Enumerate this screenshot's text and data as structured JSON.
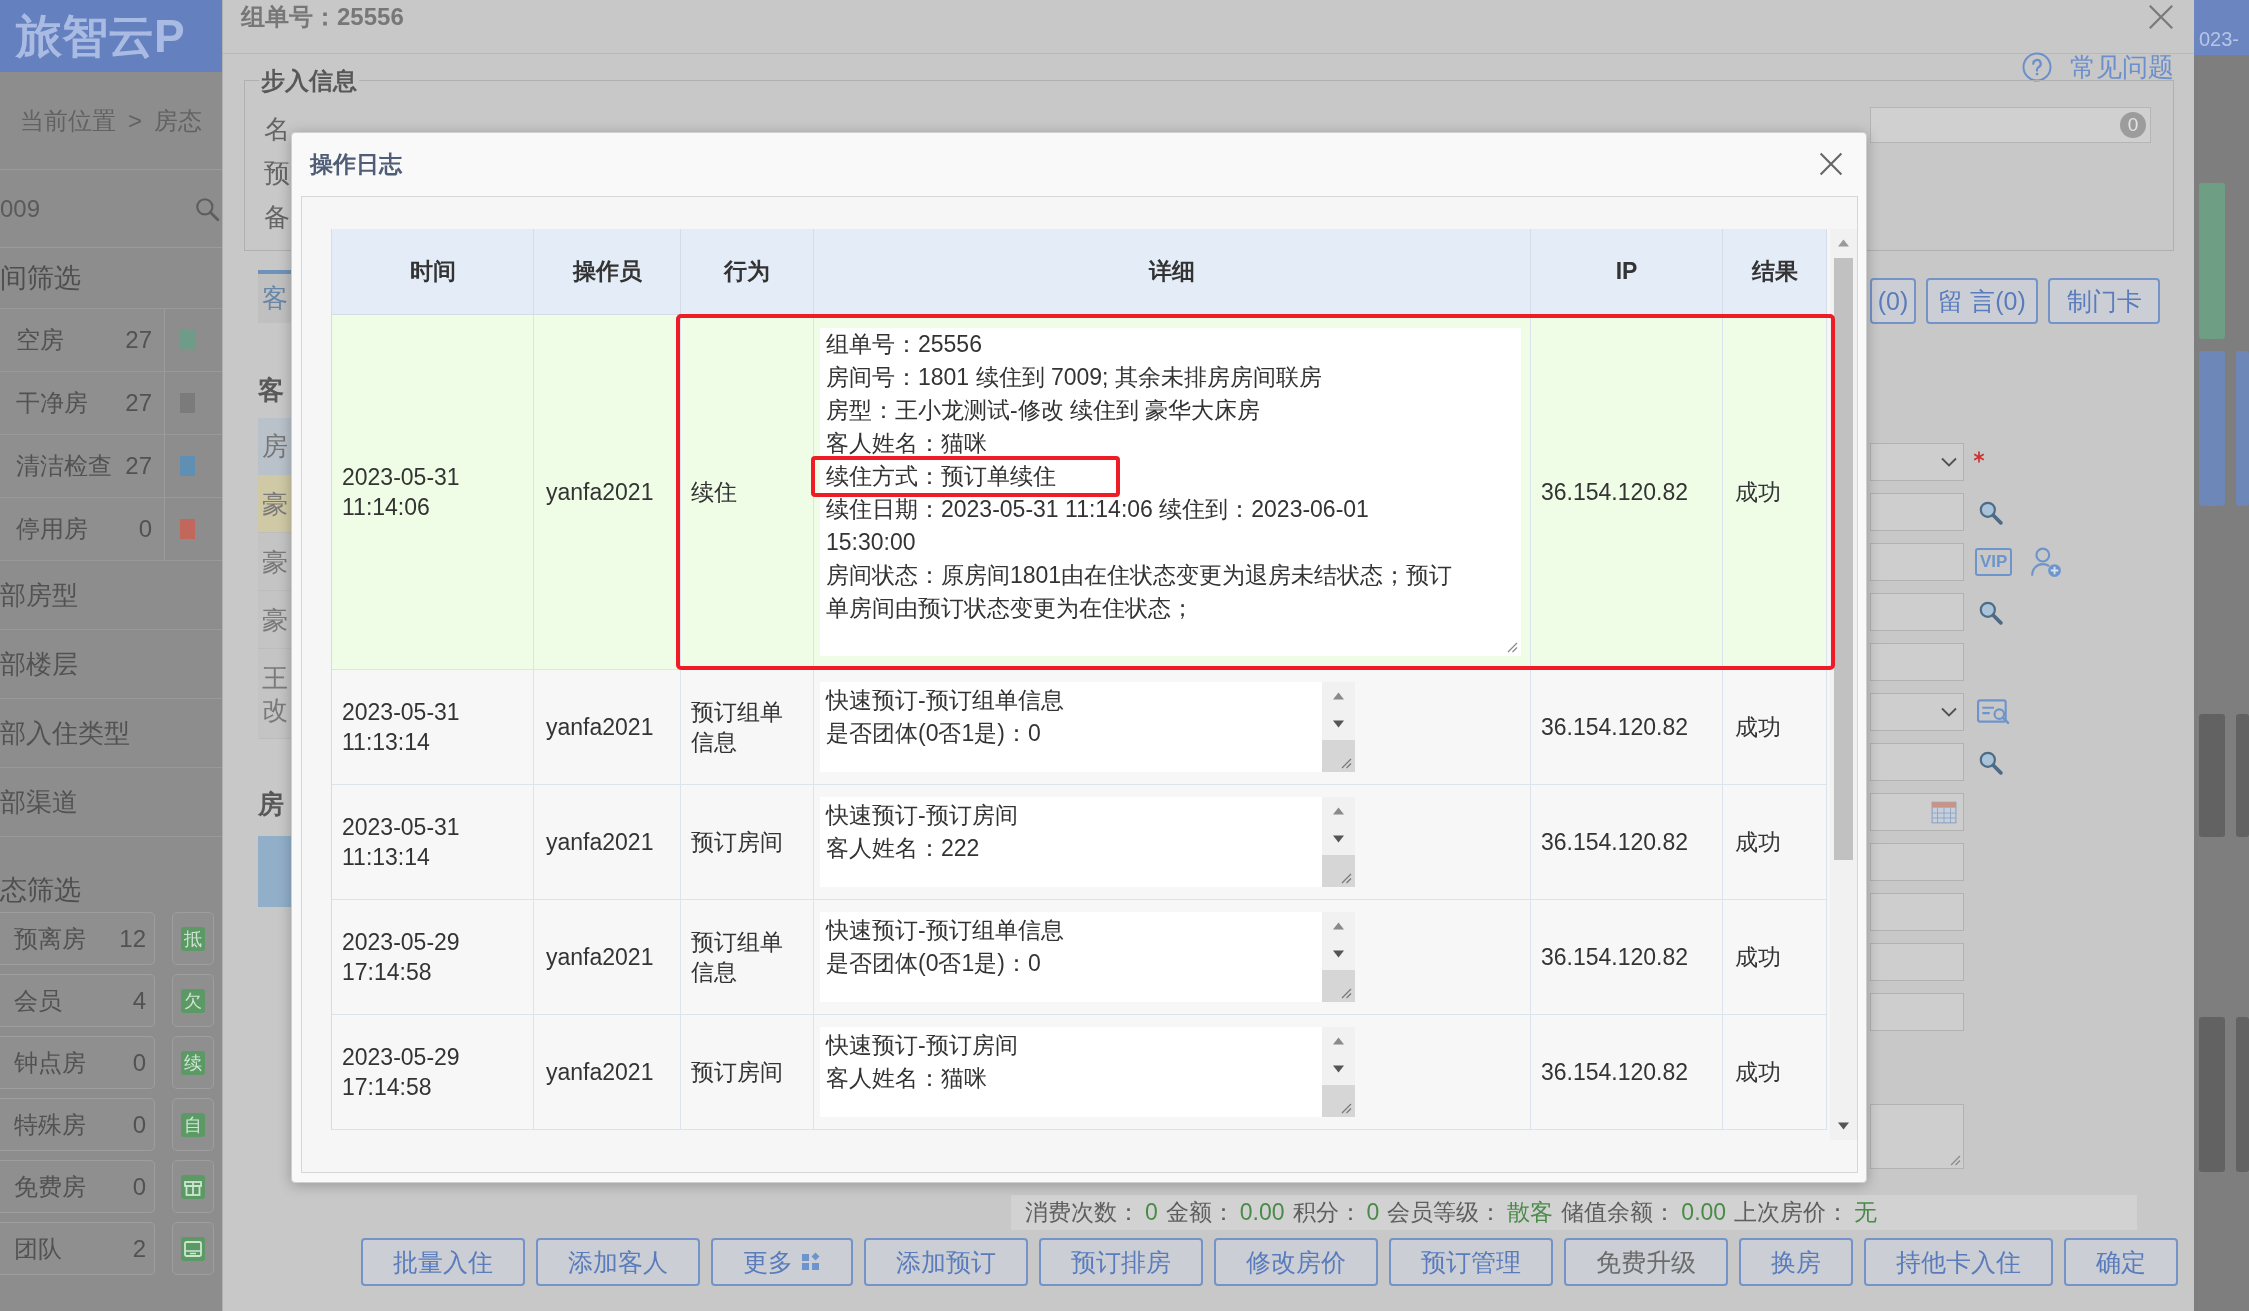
{
  "sidebar": {
    "logo": "旅智云P",
    "breadcrumb": {
      "items": [
        "当前位置",
        "房态"
      ],
      "separator": ">"
    },
    "search": {
      "value": "009"
    },
    "room_filter": {
      "title": "间筛选",
      "items": [
        {
          "label": "空房",
          "count": "27",
          "color": "#6f9c88"
        },
        {
          "label": "干净房",
          "count": "27",
          "color": "#7b7b7b"
        },
        {
          "label": "清洁检查",
          "count": "27",
          "color": "#5f8fb2"
        },
        {
          "label": "停用房",
          "count": "0",
          "color": "#c2675b"
        }
      ]
    },
    "groups": [
      "部房型",
      "部楼层",
      "部入住类型",
      "部渠道"
    ],
    "status_filter": {
      "title": "态筛选",
      "items": [
        {
          "label": "预离房",
          "count": "12",
          "kind": "tag",
          "tag": "抵"
        },
        {
          "label": "会员",
          "count": "4",
          "kind": "tag",
          "tag": "欠"
        },
        {
          "label": "钟点房",
          "count": "0",
          "kind": "tag",
          "tag": "续"
        },
        {
          "label": "特殊房",
          "count": "0",
          "kind": "tag",
          "tag": "自"
        },
        {
          "label": "免费房",
          "count": "0",
          "kind": "gift"
        },
        {
          "label": "团队",
          "count": "2",
          "kind": "card"
        }
      ]
    }
  },
  "dialog": {
    "title": "组单号：25556",
    "help": "常见问题",
    "checkin": {
      "legend": "步入信息",
      "labels": [
        "名",
        "预",
        "备"
      ],
      "order_badge": "0"
    },
    "tab": "客",
    "guest_panel": {
      "legend": "客",
      "header": "房",
      "rows": [
        {
          "text": "豪",
          "selected": true
        },
        {
          "text": "豪",
          "selected": false
        },
        {
          "text": "豪",
          "selected": false
        },
        {
          "text": "王改",
          "selected": false
        }
      ]
    },
    "room_panel": {
      "legend": "房"
    },
    "side_buttons": [
      "(0)",
      "留 言(0)",
      "制门卡"
    ],
    "fields": [
      {
        "kind": "select",
        "required": true
      },
      {
        "kind": "search",
        "required": false
      },
      {
        "kind": "vip",
        "badge": "VIP",
        "required": false
      },
      {
        "kind": "search",
        "required": false
      },
      {
        "kind": "text",
        "required": false
      },
      {
        "kind": "lookup",
        "required": false
      },
      {
        "kind": "search",
        "required": false
      },
      {
        "kind": "date",
        "required": false
      },
      {
        "kind": "text",
        "required": false
      },
      {
        "kind": "text",
        "required": false
      },
      {
        "kind": "text",
        "required": false
      },
      {
        "kind": "text",
        "required": false
      },
      {
        "kind": "textarea",
        "required": false
      }
    ],
    "summary": [
      {
        "label": "消费次数：",
        "value": "0"
      },
      {
        "label": "金额：",
        "value": "0.00"
      },
      {
        "label": "积分：",
        "value": "0"
      },
      {
        "label": "会员等级：",
        "value": "散客"
      },
      {
        "label": "储值余额：",
        "value": "0.00"
      },
      {
        "label": "上次房价：",
        "value": "无"
      }
    ],
    "buttons": [
      {
        "label": "批量入住",
        "kind": "plain",
        "disabled": false
      },
      {
        "label": "添加客人",
        "kind": "plain",
        "disabled": false
      },
      {
        "label": "更多",
        "kind": "more",
        "disabled": false
      },
      {
        "label": "添加预订",
        "kind": "plain",
        "disabled": false
      },
      {
        "label": "预订排房",
        "kind": "plain",
        "disabled": false
      },
      {
        "label": "修改房价",
        "kind": "plain",
        "disabled": false
      },
      {
        "label": "预订管理",
        "kind": "plain",
        "disabled": false
      },
      {
        "label": "免费升级",
        "kind": "plain",
        "disabled": true
      },
      {
        "label": "换房",
        "kind": "plain",
        "disabled": false
      },
      {
        "label": "持他卡入住",
        "kind": "plain",
        "disabled": false
      },
      {
        "label": "确定",
        "kind": "plain",
        "disabled": false
      }
    ]
  },
  "side_strip": {
    "date_text": "023-"
  },
  "log": {
    "title": "操作日志",
    "columns": [
      "时间",
      "操作员",
      "行为",
      "详细",
      "IP",
      "结果"
    ],
    "rows": [
      {
        "time": "2023-05-31 11:14:06",
        "operator": "yanfa2021",
        "action": "续住",
        "detail": [
          {
            "text": "组单号：25556",
            "marked": false
          },
          {
            "text": "房间号：1801 续住到 7009; 其余未排房房间联房",
            "marked": false
          },
          {
            "text": "房型：王小龙测试-修改 续住到 豪华大床房",
            "marked": false
          },
          {
            "text": "客人姓名：猫咪",
            "marked": false
          },
          {
            "text": "续住方式：预订单续住",
            "marked": true
          },
          {
            "text": "续住日期：2023-05-31 11:14:06 续住到：2023-06-01 15:30:00",
            "marked": false
          },
          {
            "text": "房间状态：原房间1801由在住状态变更为退房未结状态；预订单房间由预订状态变更为在住状态；",
            "marked": false
          }
        ],
        "ip": "36.154.120.82",
        "result": "成功",
        "selected": true,
        "marked": true
      },
      {
        "time": "2023-05-31 11:13:14",
        "operator": "yanfa2021",
        "action": "预订组单信息",
        "detail": [
          {
            "text": "快速预订-预订组单信息",
            "marked": false
          },
          {
            "text": "是否团体(0否1是)：0",
            "marked": false
          }
        ],
        "ip": "36.154.120.82",
        "result": "成功",
        "selected": false,
        "marked": false
      },
      {
        "time": "2023-05-31 11:13:14",
        "operator": "yanfa2021",
        "action": "预订房间",
        "detail": [
          {
            "text": "快速预订-预订房间",
            "marked": false
          },
          {
            "text": "客人姓名：222",
            "marked": false
          }
        ],
        "ip": "36.154.120.82",
        "result": "成功",
        "selected": false,
        "marked": false
      },
      {
        "time": "2023-05-29 17:14:58",
        "operator": "yanfa2021",
        "action": "预订组单信息",
        "detail": [
          {
            "text": "快速预订-预订组单信息",
            "marked": false
          },
          {
            "text": "是否团体(0否1是)：0",
            "marked": false
          }
        ],
        "ip": "36.154.120.82",
        "result": "成功",
        "selected": false,
        "marked": false
      },
      {
        "time": "2023-05-29 17:14:58",
        "operator": "yanfa2021",
        "action": "预订房间",
        "detail": [
          {
            "text": "快速预订-预订房间",
            "marked": false
          },
          {
            "text": "客人姓名：猫咪",
            "marked": false
          }
        ],
        "ip": "36.154.120.82",
        "result": "成功",
        "selected": false,
        "marked": false
      }
    ]
  }
}
